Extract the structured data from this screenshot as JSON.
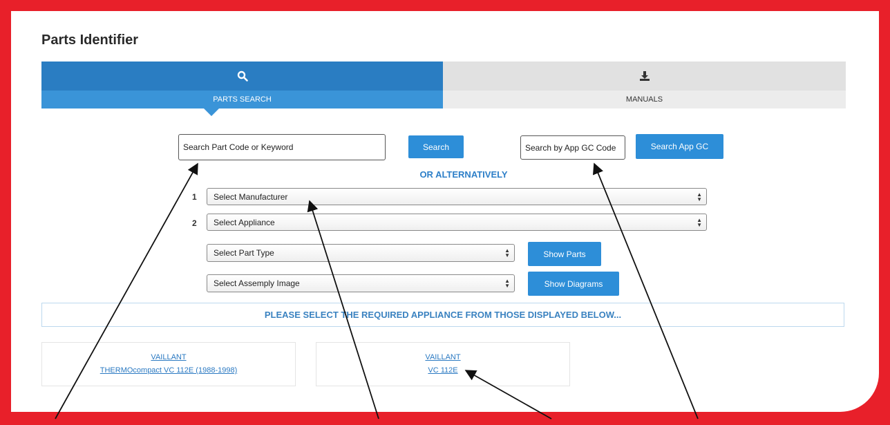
{
  "page": {
    "title": "Parts Identifier"
  },
  "tabs": [
    {
      "label": "PARTS SEARCH",
      "icon": "search-icon",
      "active": true
    },
    {
      "label": "MANUALS",
      "icon": "download-icon",
      "active": false
    }
  ],
  "search": {
    "keyword_value": "Search Part Code or Keyword",
    "search_button": "Search",
    "gc_value": "Search by App GC Code",
    "gc_button": "Search App GC"
  },
  "alternatively": "OR ALTERNATIVELY",
  "steps": {
    "manufacturer": {
      "number": "1",
      "value": "Select Manufacturer"
    },
    "appliance": {
      "number": "2",
      "value": "Select Appliance"
    },
    "part_type": {
      "value": "Select Part Type",
      "button": "Show Parts"
    },
    "assembly_image": {
      "value": "Select Assemply Image",
      "button": "Show Diagrams"
    }
  },
  "banner": "PLEASE SELECT THE REQUIRED APPLIANCE FROM THOSE DISPLAYED BELOW...",
  "results": [
    {
      "brand": "VAILLANT",
      "model": "THERMOcompact VC 112E (1988-1998)"
    },
    {
      "brand": "VAILLANT",
      "model": "VC 112E"
    }
  ],
  "colors": {
    "frame": "#e8202a",
    "accent": "#2d8ed8",
    "tab_active": "#2a7dc2"
  }
}
